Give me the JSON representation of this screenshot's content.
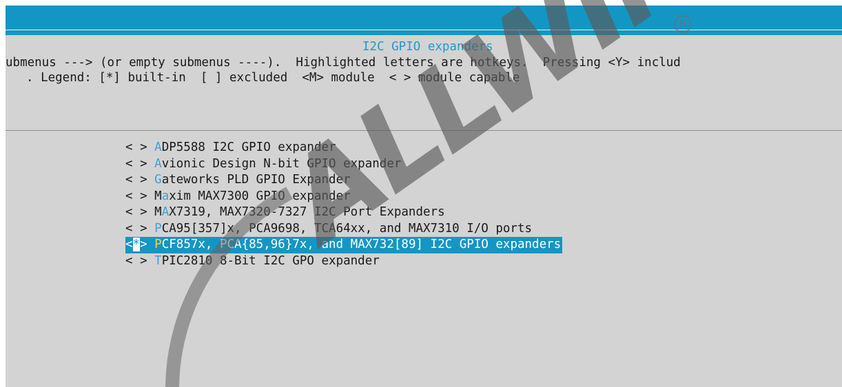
{
  "header": {
    "title": "I2C GPIO expanders"
  },
  "help": {
    "line1": "ubmenus ---> (or empty submenus ----).  Highlighted letters are hotkeys.  Pressing <Y> includ",
    "line2": ". Legend: [*] built-in  [ ] excluded  <M> module  < > module capable"
  },
  "menu": {
    "items": [
      {
        "state": "< > ",
        "hotkey": "A",
        "rest": "DP5588 I2C GPIO expander"
      },
      {
        "state": "< > ",
        "hotkey": "A",
        "rest": "vionic Design N-bit GPIO expander"
      },
      {
        "state": "< > ",
        "hotkey": "G",
        "rest": "ateworks PLD GPIO Expander"
      },
      {
        "state": "< > ",
        "pre": "M",
        "hotkey": "a",
        "rest": "xim MAX7300 GPIO expander"
      },
      {
        "state": "< > ",
        "pre": "M",
        "hotkey": "A",
        "rest": "X7319, MAX7320-7327 I2C Port Expanders"
      },
      {
        "state": "< > ",
        "hotkey": "P",
        "rest": "CA95[357]x, PCA9698, TCA64xx, and MAX7310 I/O ports"
      },
      {
        "state_open": "<",
        "state_mark": "*",
        "state_close": "> ",
        "hotkey": "P",
        "rest": "CF857x, PCA{85,96}7x, and MAX732[89] I2C GPIO expanders",
        "selected": true
      },
      {
        "state": "< > ",
        "hotkey": "T",
        "rest": "PIC2810 8-Bit I2C GPO expander"
      }
    ]
  },
  "watermark": {
    "text": "ALLWINER",
    "mark": "R"
  },
  "colors": {
    "accent": "#1496c4",
    "panel": "#d3d3d3",
    "hotkey": "#3fa0d8",
    "hotkey_selected": "#f3d34a"
  }
}
